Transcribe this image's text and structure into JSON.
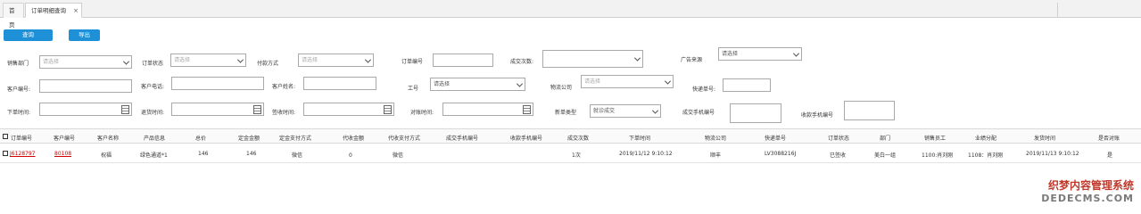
{
  "tabs": [
    {
      "label": "首页"
    },
    {
      "label": "订单明细查询"
    }
  ],
  "toolbar": {
    "query_label": "查询",
    "export_label": "导出"
  },
  "filters": {
    "sales_dept": {
      "label": "销售部门",
      "value": "请选择"
    },
    "order_status": {
      "label": "订单状态",
      "value": "请选择"
    },
    "pay_method": {
      "label": "付款方式",
      "value": "请选择"
    },
    "order_no": {
      "label": "订单编号",
      "value": ""
    },
    "deal_count": {
      "label": "成交次数:",
      "value": ""
    },
    "ad_source": {
      "label": "广告来源",
      "value": "请选择"
    },
    "customer_no": {
      "label": "客户编号:",
      "value": ""
    },
    "customer_phone": {
      "label": "客户电话:",
      "value": ""
    },
    "customer_name": {
      "label": "客户姓名:",
      "value": ""
    },
    "employee_no": {
      "label": "工号",
      "value": "请选择"
    },
    "logistics": {
      "label": "物流公司",
      "value": "请选择"
    },
    "tracking_no": {
      "label": "快递单号:",
      "value": ""
    },
    "order_time": {
      "label": "下单时间:",
      "value": ""
    },
    "return_time": {
      "label": "退货时间:",
      "value": ""
    },
    "sign_time": {
      "label": "签收时间:",
      "value": ""
    },
    "reconcile_time": {
      "label": "对账时间:",
      "value": ""
    },
    "new_order_type": {
      "label": "新单类型",
      "value": "就诊成交"
    },
    "deal_phone": {
      "label": "成交手机编号",
      "value": ""
    },
    "collect_phone": {
      "label": "收款手机编号",
      "value": ""
    }
  },
  "table": {
    "headers": [
      "订单编号",
      "客户编号",
      "客户名称",
      "产品信息",
      "总价",
      "定金金额",
      "定金支付方式",
      "代收金额",
      "代收支付方式",
      "成交手机编号",
      "收款手机编号",
      "成交次数",
      "下单时间",
      "物流公司",
      "快递单号",
      "订单状态",
      "部门",
      "销售员工",
      "业绩分配",
      "发货时间",
      "是否对账"
    ],
    "rows": [
      [
        "J6128797",
        "80108",
        "祝福",
        "绿色通道*1",
        "146",
        "146",
        "微信",
        "0",
        "微信",
        "",
        "",
        "1次",
        "2019/11/12 9:10:12",
        "顺丰",
        "LV3088216J",
        "已签收",
        "美白一组",
        "1100:肖刘刚",
        "1108：肖刘刚",
        "2019/11/13 9:10:12",
        "是"
      ]
    ]
  },
  "watermark": {
    "line1": "织梦内容管理系统",
    "line2": "DEDECMS.COM"
  }
}
